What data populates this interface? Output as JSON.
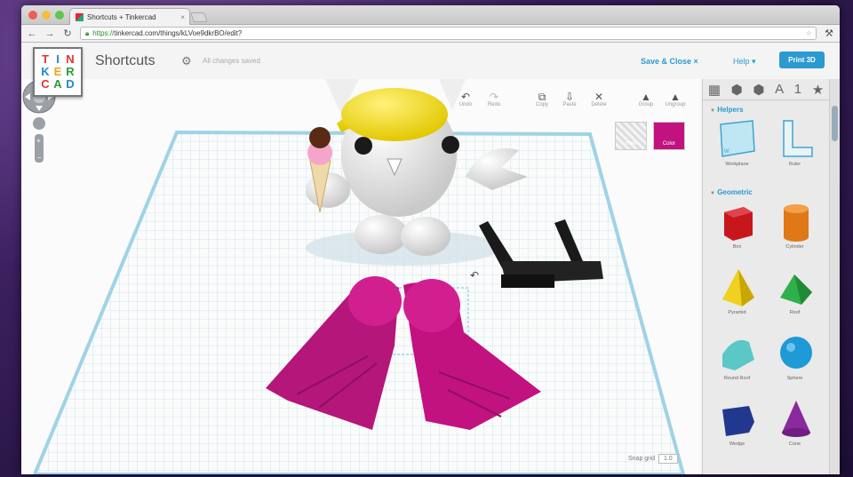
{
  "browser": {
    "tab_title": "Shortcuts + Tinkercad",
    "tab_close": "×",
    "url_scheme": "https://",
    "url_rest": "tinkercad.com/things/kLVoe9dkrBO/edit?"
  },
  "app": {
    "logo_letters": [
      "T",
      "I",
      "N",
      "K",
      "E",
      "R",
      "C",
      "A",
      "D"
    ],
    "design_title": "Shortcuts",
    "save_status": "All changes saved",
    "save_close": "Save & Close ×",
    "help": "Help ▾",
    "print3d": "Print 3D"
  },
  "edit_tools": [
    {
      "label": "Undo",
      "icon": "undo-icon",
      "glyph": "↶"
    },
    {
      "label": "Redo",
      "icon": "redo-icon",
      "glyph": "↷"
    },
    {
      "label": "Copy",
      "icon": "copy-icon",
      "glyph": "⧉"
    },
    {
      "label": "Paste",
      "icon": "paste-icon",
      "glyph": "⇩"
    },
    {
      "label": "Delete",
      "icon": "delete-icon",
      "glyph": "✕"
    },
    {
      "label": "Group",
      "icon": "group-icon",
      "glyph": "▲"
    },
    {
      "label": "Ungroup",
      "icon": "ungroup-icon",
      "glyph": "▲"
    }
  ],
  "tiles": {
    "hole": "Hole",
    "color": "Color",
    "color_hex": "#c2127f"
  },
  "snap_grid": {
    "label": "Snap grid",
    "value": "1.0"
  },
  "sidebar": {
    "category_tabs": [
      "▦",
      "⬢",
      "⬢",
      "A",
      "1",
      "★"
    ],
    "helpers_title": "Helpers",
    "helpers": [
      {
        "label": "Workplane"
      },
      {
        "label": "Ruler"
      }
    ],
    "geometric_title": "Geometric",
    "geometric": [
      {
        "label": "Box",
        "color": "#c8161d"
      },
      {
        "label": "Cylinder",
        "color": "#e07818"
      },
      {
        "label": "Pyramid",
        "color": "#f0d020"
      },
      {
        "label": "Roof",
        "color": "#2fb04a"
      },
      {
        "label": "Round Roof",
        "color": "#5cc7c7"
      },
      {
        "label": "Sphere",
        "color": "#1e9ad6"
      },
      {
        "label": "Wedge",
        "color": "#22388f"
      },
      {
        "label": "Cone",
        "color": "#8a2a9c"
      }
    ]
  }
}
